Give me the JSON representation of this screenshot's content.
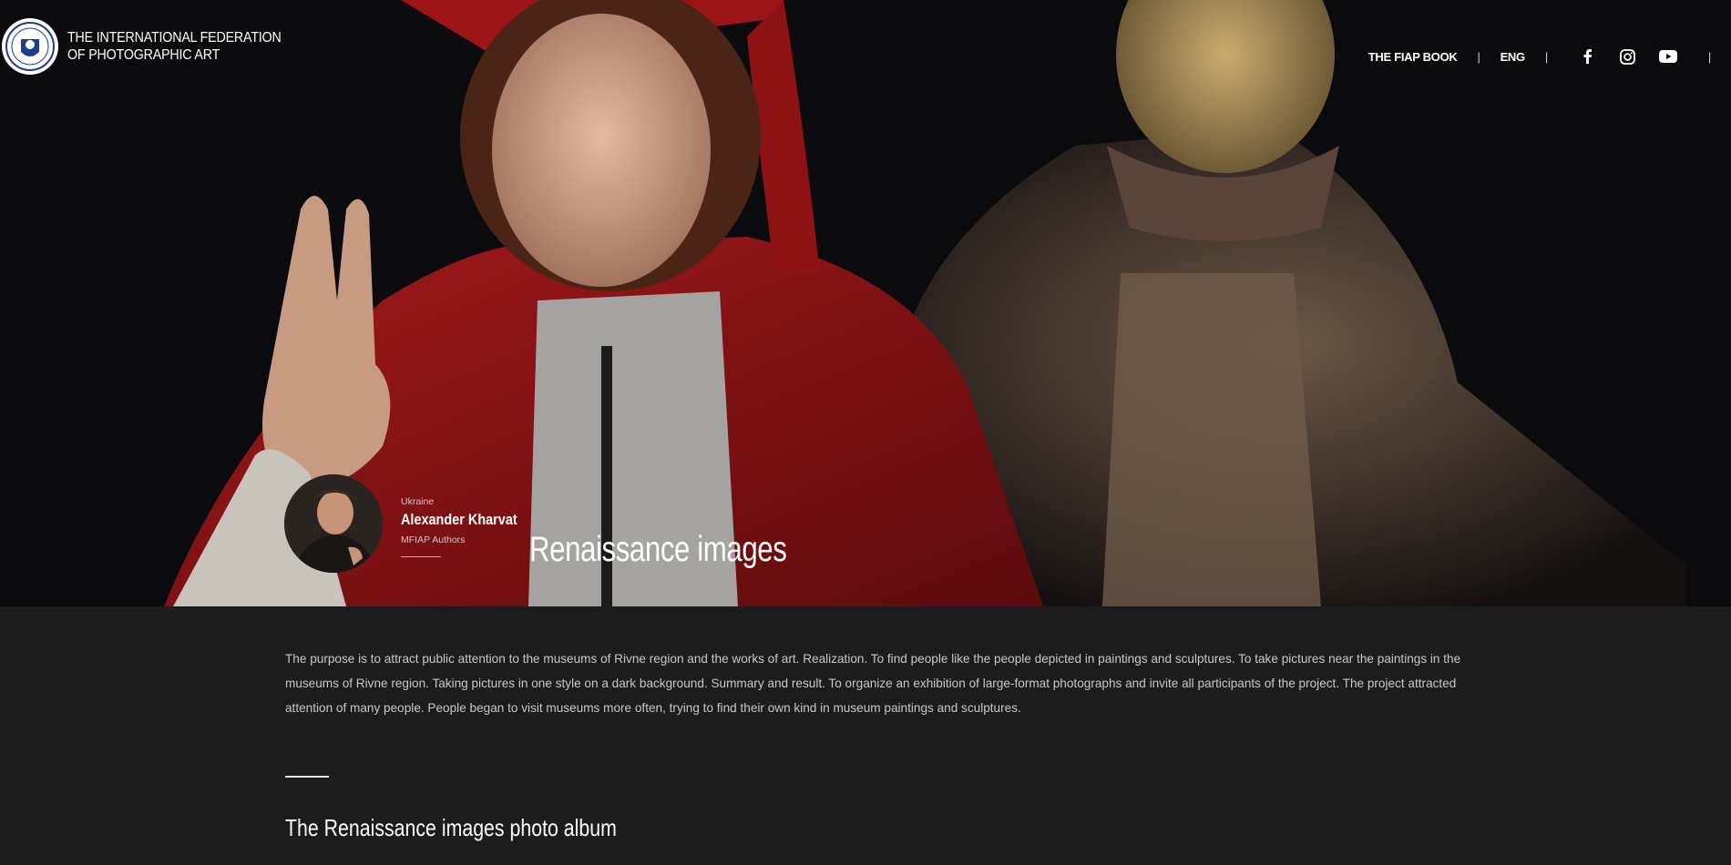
{
  "header": {
    "org_line1": "THE INTERNATIONAL FEDERATION",
    "org_line2": "OF PHOTOGRAPHIC ART",
    "logo_icon": "fiap-emblem-icon"
  },
  "nav": {
    "book_label": "THE FIAP BOOK",
    "language_label": "ENG",
    "separator": "|",
    "icons": [
      "facebook-icon",
      "instagram-icon",
      "youtube-icon"
    ]
  },
  "author": {
    "country": "Ukraine",
    "name": "Alexander Kharvat",
    "role": "MFIAP Authors"
  },
  "project": {
    "title": "Renaissance images",
    "description": "The purpose is to attract public attention to the museums of Rivne region and the works of art. Realization. To find people like the people depicted in paintings and sculptures. To take pictures near the paintings in the museums of Rivne region. Taking pictures in one style on a dark background. Summary and result. To organize an exhibition of large-format photographs and invite all participants  of the project. The project attracted attention of many people. People began to visit museums more often, trying to find their own kind in museum paintings and sculptures.",
    "album_title": "The Renaissance images photo album"
  },
  "colors": {
    "hero_background": "#0b0b0d",
    "content_background": "#1c1c1c",
    "robe_red": "#8e1414",
    "text_muted": "#c8c8c8"
  }
}
